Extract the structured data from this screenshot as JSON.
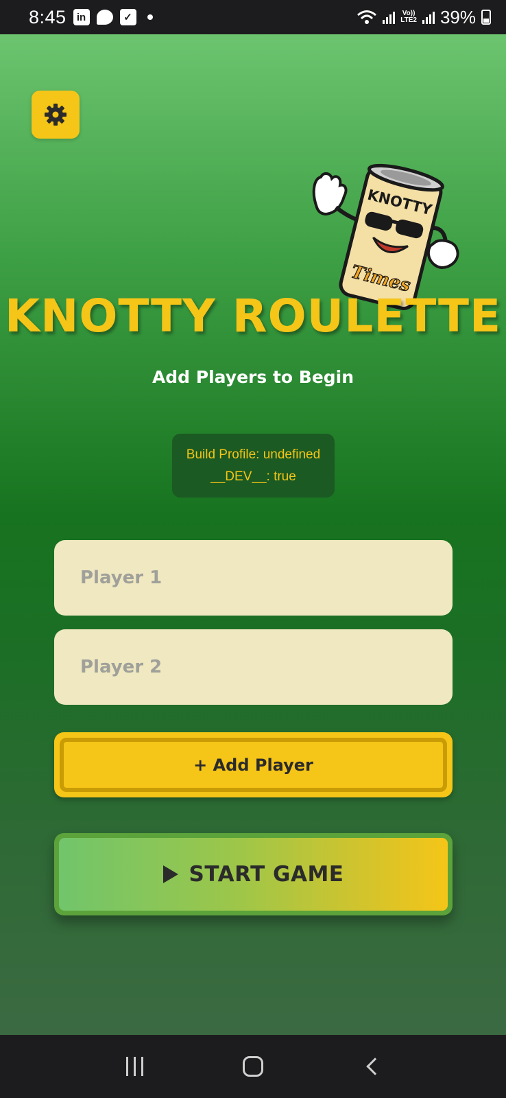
{
  "status_bar": {
    "time": "8:45",
    "linkedin_label": "in",
    "battery_percent": "39%",
    "network_label_top": "Vo))",
    "network_label_bottom": "LTE2"
  },
  "app": {
    "mascot_text_top": "KNOTTY",
    "mascot_text_bottom": "Times",
    "title": "KNOTTY ROULETTE",
    "subtitle": "Add Players to Begin",
    "debug": {
      "line1": "Build Profile: undefined",
      "line2": "__DEV__: true"
    },
    "players": [
      {
        "placeholder": "Player 1",
        "value": ""
      },
      {
        "placeholder": "Player 2",
        "value": ""
      }
    ],
    "add_player_label": "+ Add Player",
    "start_game_label": "START GAME"
  },
  "colors": {
    "accent_yellow": "#f5c518",
    "input_bg": "#efe8c0",
    "green_top": "#6cc46f",
    "green_mid": "#17731f"
  },
  "icons": {
    "settings": "gear-icon",
    "play": "play-icon",
    "nav": [
      "recents-icon",
      "home-icon",
      "back-icon"
    ]
  }
}
